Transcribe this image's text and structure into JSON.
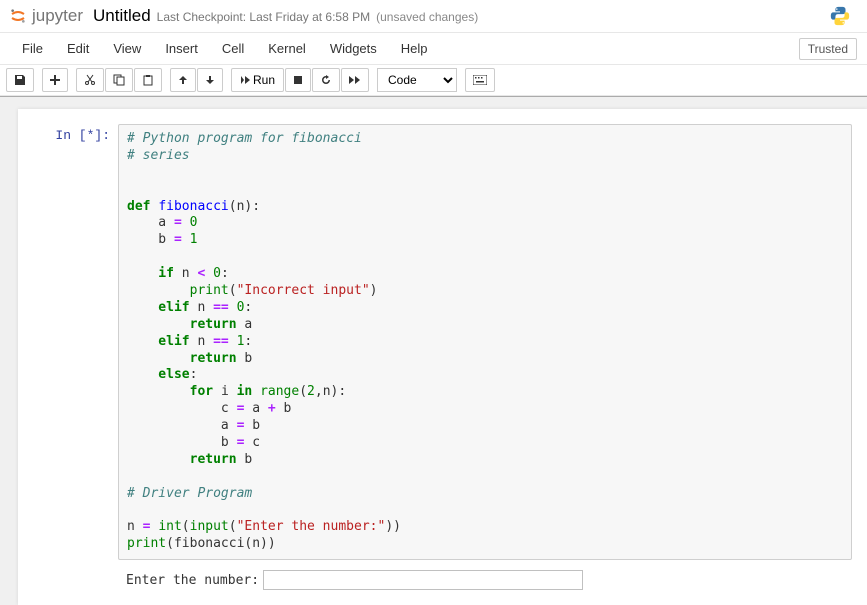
{
  "header": {
    "brand": "jupyter",
    "title": "Untitled",
    "checkpoint": "Last Checkpoint: Last Friday at 6:58 PM",
    "unsaved": "(unsaved changes)"
  },
  "menu": {
    "items": [
      "File",
      "Edit",
      "View",
      "Insert",
      "Cell",
      "Kernel",
      "Widgets",
      "Help"
    ],
    "trusted": "Trusted"
  },
  "toolbar": {
    "run_label": "Run",
    "cell_type": "Code"
  },
  "cell": {
    "prompt": "In [*]:",
    "code": {
      "c1": "# Python program for fibonacci",
      "c2": "# series",
      "l_def": "def ",
      "fn": "fibonacci",
      "lp": "(n):",
      "a_eq": "    a ",
      "eq": "=",
      "sp": " ",
      "zero": "0",
      "b_eq": "    b ",
      "one": "1",
      "if": "    if ",
      "n": "n ",
      "lt": "<",
      "colon": ":",
      "print_ind": "        ",
      "print": "print",
      "str_bad": "\"Incorrect input\"",
      "rp": ")",
      "elif": "    elif ",
      "eqeq": "==",
      "return_ind": "        ",
      "return": "return ",
      "a": "a",
      "b": "b",
      "else": "    else",
      "for_ind": "        ",
      "for": "for ",
      "i": "i ",
      "in": "in ",
      "range": "range",
      "two": "2",
      "comma_n": ",n):",
      "c_eq": "            c ",
      "plus": "+",
      "a_eq2": "            a ",
      "b_eq2": "            b ",
      "c": "c",
      "return2_ind": "        ",
      "driver": "# Driver Program",
      "n_eq": "n ",
      "int": "int",
      "input": "input",
      "str_enter": "\"Enter the number:\"",
      "rrp": "))",
      "printcall": "(fibonacci(n))"
    }
  },
  "output": {
    "prompt_text": "Enter the number:",
    "input_value": ""
  }
}
